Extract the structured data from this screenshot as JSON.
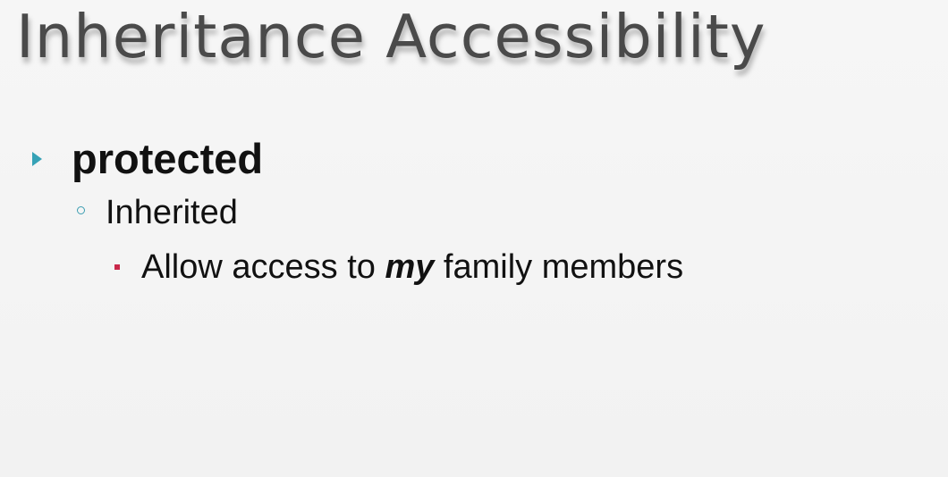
{
  "slide": {
    "title": "Inheritance Accessibility",
    "bullets": {
      "level1": "protected",
      "level2": "Inherited",
      "level3": {
        "before": "Allow access to ",
        "emphasis": "my",
        "after": " family members"
      }
    },
    "icons": {
      "level1_marker": "triangle-right-icon",
      "level2_marker": "hollow-circle-icon",
      "level3_marker": "square-bullet-icon"
    },
    "colors": {
      "level1_marker": "#36a2b6",
      "level2_marker": "#3b9db1",
      "level3_marker": "#c9284a",
      "title": "#4a4a4a"
    }
  }
}
